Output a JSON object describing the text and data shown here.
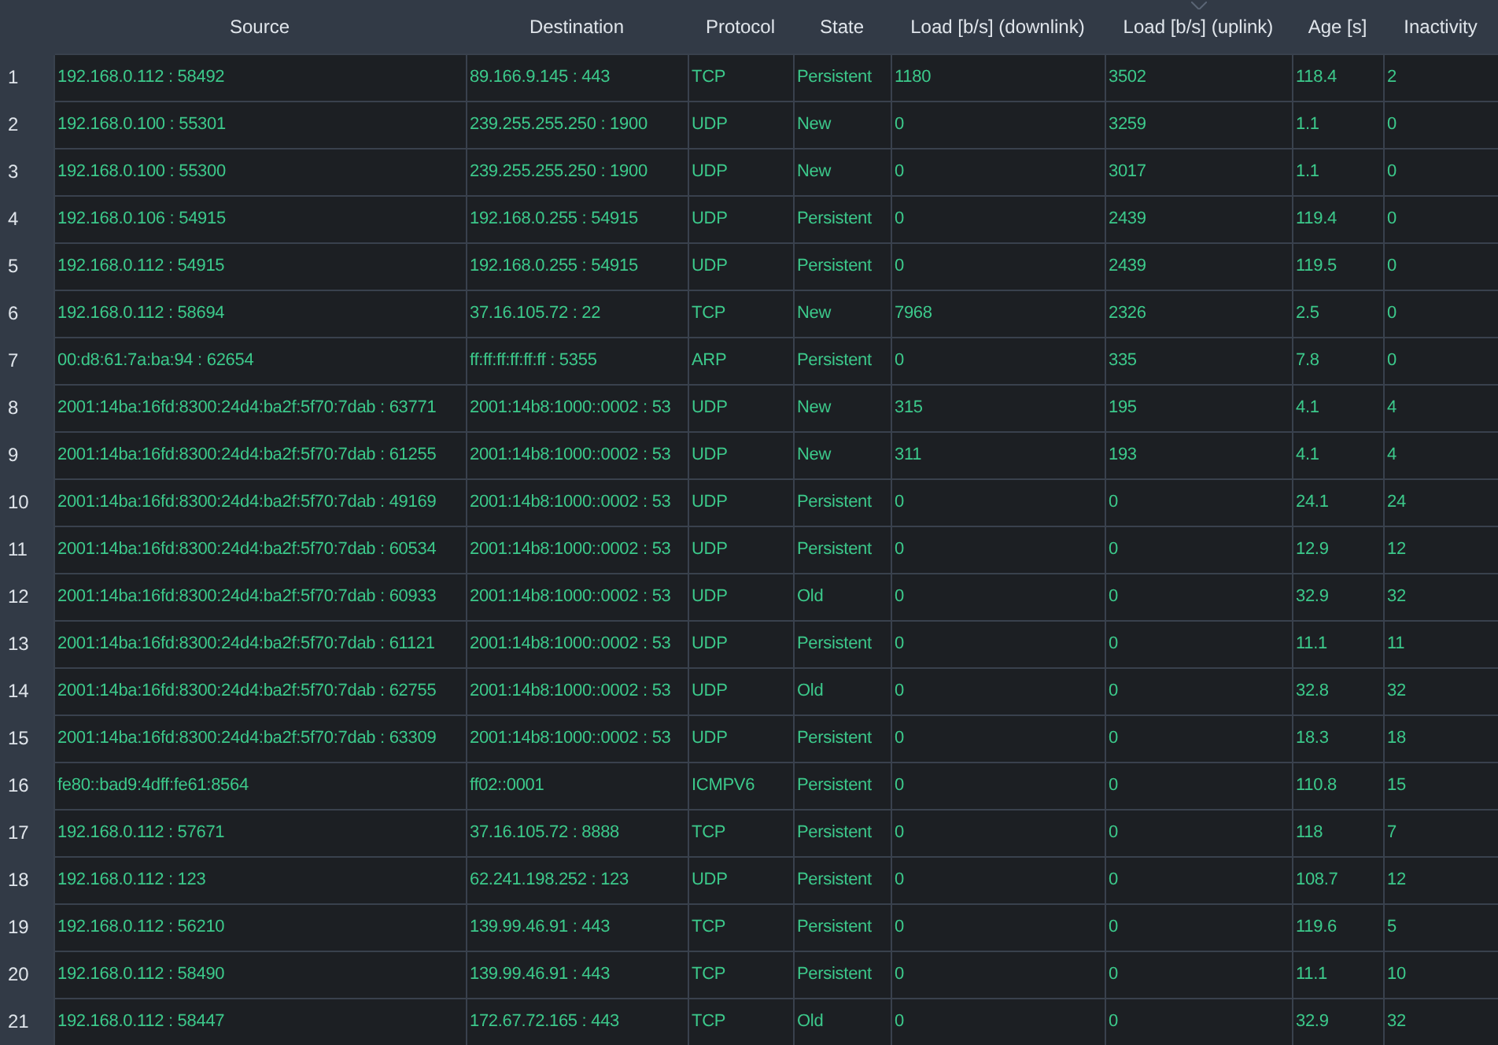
{
  "table": {
    "columns": [
      {
        "label": "Source",
        "sorted": false
      },
      {
        "label": "Destination",
        "sorted": false
      },
      {
        "label": "Protocol",
        "sorted": false
      },
      {
        "label": "State",
        "sorted": false
      },
      {
        "label": "Load [b/s] (downlink)",
        "sorted": false
      },
      {
        "label": "Load [b/s] (uplink)",
        "sorted": true
      },
      {
        "label": "Age [s]",
        "sorted": false
      },
      {
        "label": "Inactivity",
        "sorted": false
      }
    ],
    "rows": [
      {
        "number": "1",
        "cells": [
          "192.168.0.112 : 58492",
          "89.166.9.145 : 443",
          "TCP",
          "Persistent",
          "1180",
          "3502",
          "118.4",
          "2"
        ]
      },
      {
        "number": "2",
        "cells": [
          "192.168.0.100 : 55301",
          "239.255.255.250 : 1900",
          "UDP",
          "New",
          "0",
          "3259",
          "1.1",
          "0"
        ]
      },
      {
        "number": "3",
        "cells": [
          "192.168.0.100 : 55300",
          "239.255.255.250 : 1900",
          "UDP",
          "New",
          "0",
          "3017",
          "1.1",
          "0"
        ]
      },
      {
        "number": "4",
        "cells": [
          "192.168.0.106 : 54915",
          "192.168.0.255 : 54915",
          "UDP",
          "Persistent",
          "0",
          "2439",
          "119.4",
          "0"
        ]
      },
      {
        "number": "5",
        "cells": [
          "192.168.0.112 : 54915",
          "192.168.0.255 : 54915",
          "UDP",
          "Persistent",
          "0",
          "2439",
          "119.5",
          "0"
        ]
      },
      {
        "number": "6",
        "cells": [
          "192.168.0.112 : 58694",
          "37.16.105.72 : 22",
          "TCP",
          "New",
          "7968",
          "2326",
          "2.5",
          "0"
        ]
      },
      {
        "number": "7",
        "cells": [
          "00:d8:61:7a:ba:94 : 62654",
          "ff:ff:ff:ff:ff:ff : 5355",
          "ARP",
          "Persistent",
          "0",
          "335",
          "7.8",
          "0"
        ]
      },
      {
        "number": "8",
        "cells": [
          "2001:14ba:16fd:8300:24d4:ba2f:5f70:7dab : 63771",
          "2001:14b8:1000::0002 : 53",
          "UDP",
          "New",
          "315",
          "195",
          "4.1",
          "4"
        ]
      },
      {
        "number": "9",
        "cells": [
          "2001:14ba:16fd:8300:24d4:ba2f:5f70:7dab : 61255",
          "2001:14b8:1000::0002 : 53",
          "UDP",
          "New",
          "311",
          "193",
          "4.1",
          "4"
        ]
      },
      {
        "number": "10",
        "cells": [
          "2001:14ba:16fd:8300:24d4:ba2f:5f70:7dab : 49169",
          "2001:14b8:1000::0002 : 53",
          "UDP",
          "Persistent",
          "0",
          "0",
          "24.1",
          "24"
        ]
      },
      {
        "number": "11",
        "cells": [
          "2001:14ba:16fd:8300:24d4:ba2f:5f70:7dab : 60534",
          "2001:14b8:1000::0002 : 53",
          "UDP",
          "Persistent",
          "0",
          "0",
          "12.9",
          "12"
        ]
      },
      {
        "number": "12",
        "cells": [
          "2001:14ba:16fd:8300:24d4:ba2f:5f70:7dab : 60933",
          "2001:14b8:1000::0002 : 53",
          "UDP",
          "Old",
          "0",
          "0",
          "32.9",
          "32"
        ]
      },
      {
        "number": "13",
        "cells": [
          "2001:14ba:16fd:8300:24d4:ba2f:5f70:7dab : 61121",
          "2001:14b8:1000::0002 : 53",
          "UDP",
          "Persistent",
          "0",
          "0",
          "11.1",
          "11"
        ]
      },
      {
        "number": "14",
        "cells": [
          "2001:14ba:16fd:8300:24d4:ba2f:5f70:7dab : 62755",
          "2001:14b8:1000::0002 : 53",
          "UDP",
          "Old",
          "0",
          "0",
          "32.8",
          "32"
        ]
      },
      {
        "number": "15",
        "cells": [
          "2001:14ba:16fd:8300:24d4:ba2f:5f70:7dab : 63309",
          "2001:14b8:1000::0002 : 53",
          "UDP",
          "Persistent",
          "0",
          "0",
          "18.3",
          "18"
        ]
      },
      {
        "number": "16",
        "cells": [
          "fe80::bad9:4dff:fe61:8564",
          "ff02::0001",
          "ICMPV6",
          "Persistent",
          "0",
          "0",
          "110.8",
          "15"
        ]
      },
      {
        "number": "17",
        "cells": [
          "192.168.0.112 : 57671",
          "37.16.105.72 : 8888",
          "TCP",
          "Persistent",
          "0",
          "0",
          "118",
          "7"
        ]
      },
      {
        "number": "18",
        "cells": [
          "192.168.0.112 : 123",
          "62.241.198.252 : 123",
          "UDP",
          "Persistent",
          "0",
          "0",
          "108.7",
          "12"
        ]
      },
      {
        "number": "19",
        "cells": [
          "192.168.0.112 : 56210",
          "139.99.46.91 : 443",
          "TCP",
          "Persistent",
          "0",
          "0",
          "119.6",
          "5"
        ]
      },
      {
        "number": "20",
        "cells": [
          "192.168.0.112 : 58490",
          "139.99.46.91 : 443",
          "TCP",
          "Persistent",
          "0",
          "0",
          "11.1",
          "10"
        ]
      },
      {
        "number": "21",
        "cells": [
          "192.168.0.112 : 58447",
          "172.67.72.165 : 443",
          "TCP",
          "Old",
          "0",
          "0",
          "32.9",
          "32"
        ]
      }
    ]
  }
}
